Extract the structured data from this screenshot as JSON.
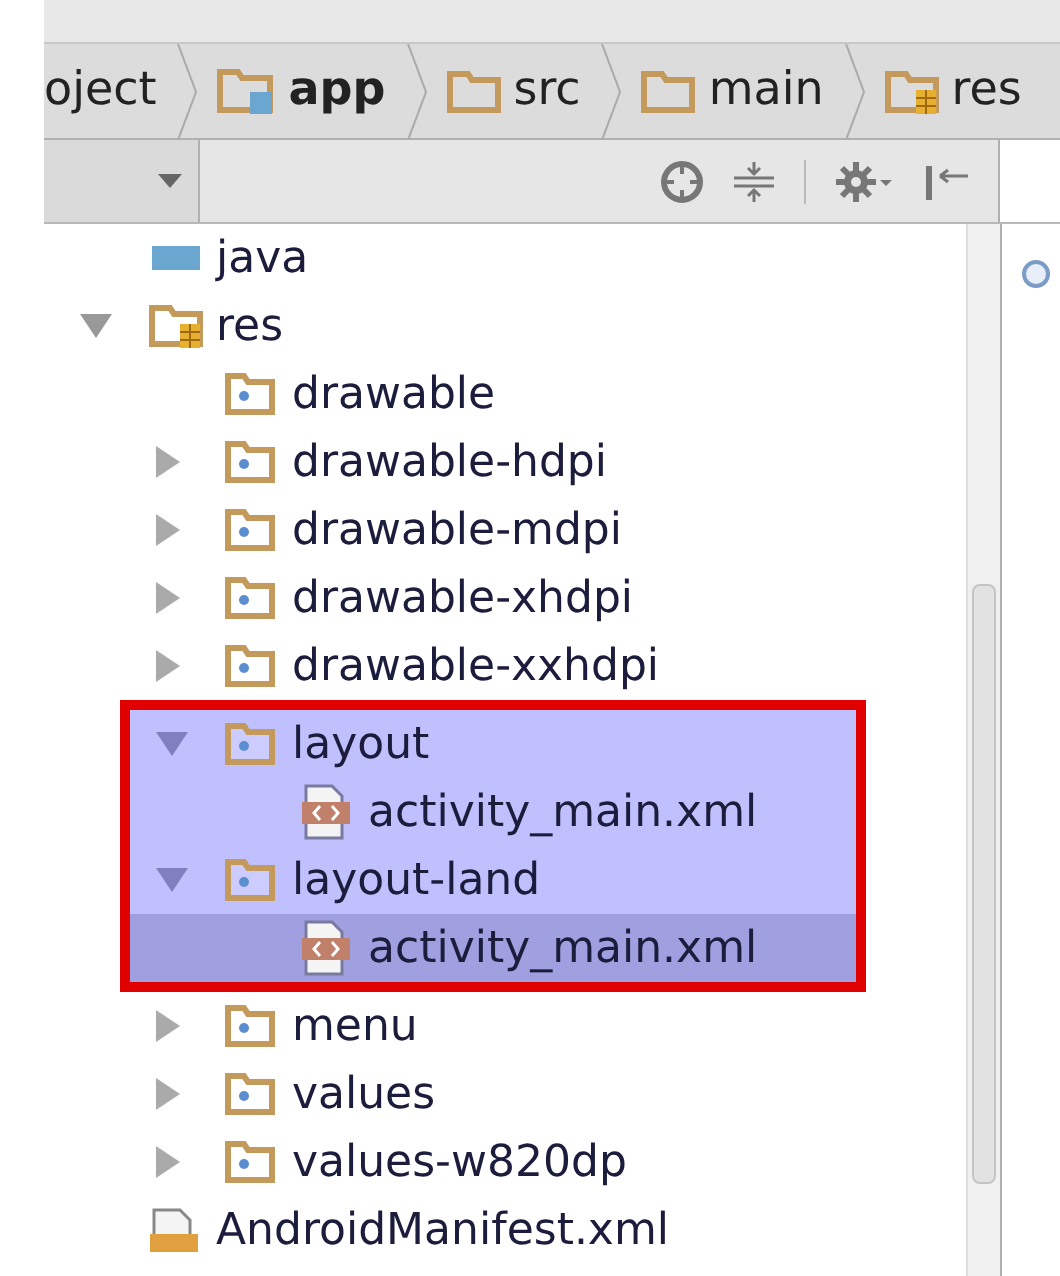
{
  "breadcrumbs": [
    {
      "label": "oject",
      "bold": false
    },
    {
      "label": "app",
      "kind": "module",
      "bold": true
    },
    {
      "label": "src",
      "kind": "folder",
      "bold": false
    },
    {
      "label": "main",
      "kind": "folder",
      "bold": false
    },
    {
      "label": "res",
      "kind": "resources",
      "bold": false
    }
  ],
  "tree": [
    {
      "label": "java",
      "kind": "source",
      "highlighted": false,
      "selected": false
    },
    {
      "label": "res",
      "kind": "resources",
      "expanded": true,
      "highlighted": false,
      "selected": false,
      "children": [
        {
          "label": "drawable",
          "kind": "resfolder",
          "highlighted": false,
          "selected": false
        },
        {
          "label": "drawable-hdpi",
          "kind": "resfolder",
          "expanded": false,
          "highlighted": false,
          "selected": false
        },
        {
          "label": "drawable-mdpi",
          "kind": "resfolder",
          "expanded": false,
          "highlighted": false,
          "selected": false
        },
        {
          "label": "drawable-xhdpi",
          "kind": "resfolder",
          "expanded": false,
          "highlighted": false,
          "selected": false
        },
        {
          "label": "drawable-xxhdpi",
          "kind": "resfolder",
          "expanded": false,
          "highlighted": false,
          "selected": false
        },
        {
          "label": "layout",
          "kind": "resfolder",
          "expanded": true,
          "highlighted": true,
          "selected": false,
          "children": [
            {
              "label": "activity_main.xml",
              "kind": "xml",
              "highlighted": true,
              "selected": false
            }
          ]
        },
        {
          "label": "layout-land",
          "kind": "resfolder",
          "expanded": true,
          "highlighted": true,
          "selected": false,
          "children": [
            {
              "label": "activity_main.xml",
              "kind": "xml",
              "highlighted": true,
              "selected": true
            }
          ]
        },
        {
          "label": "menu",
          "kind": "resfolder",
          "expanded": false,
          "highlighted": false,
          "selected": false
        },
        {
          "label": "values",
          "kind": "resfolder",
          "expanded": false,
          "highlighted": false,
          "selected": false
        },
        {
          "label": "values-w820dp",
          "kind": "resfolder",
          "expanded": false,
          "highlighted": false,
          "selected": false
        }
      ]
    },
    {
      "label": "AndroidManifest.xml",
      "kind": "manifest",
      "highlighted": false,
      "selected": false
    }
  ]
}
